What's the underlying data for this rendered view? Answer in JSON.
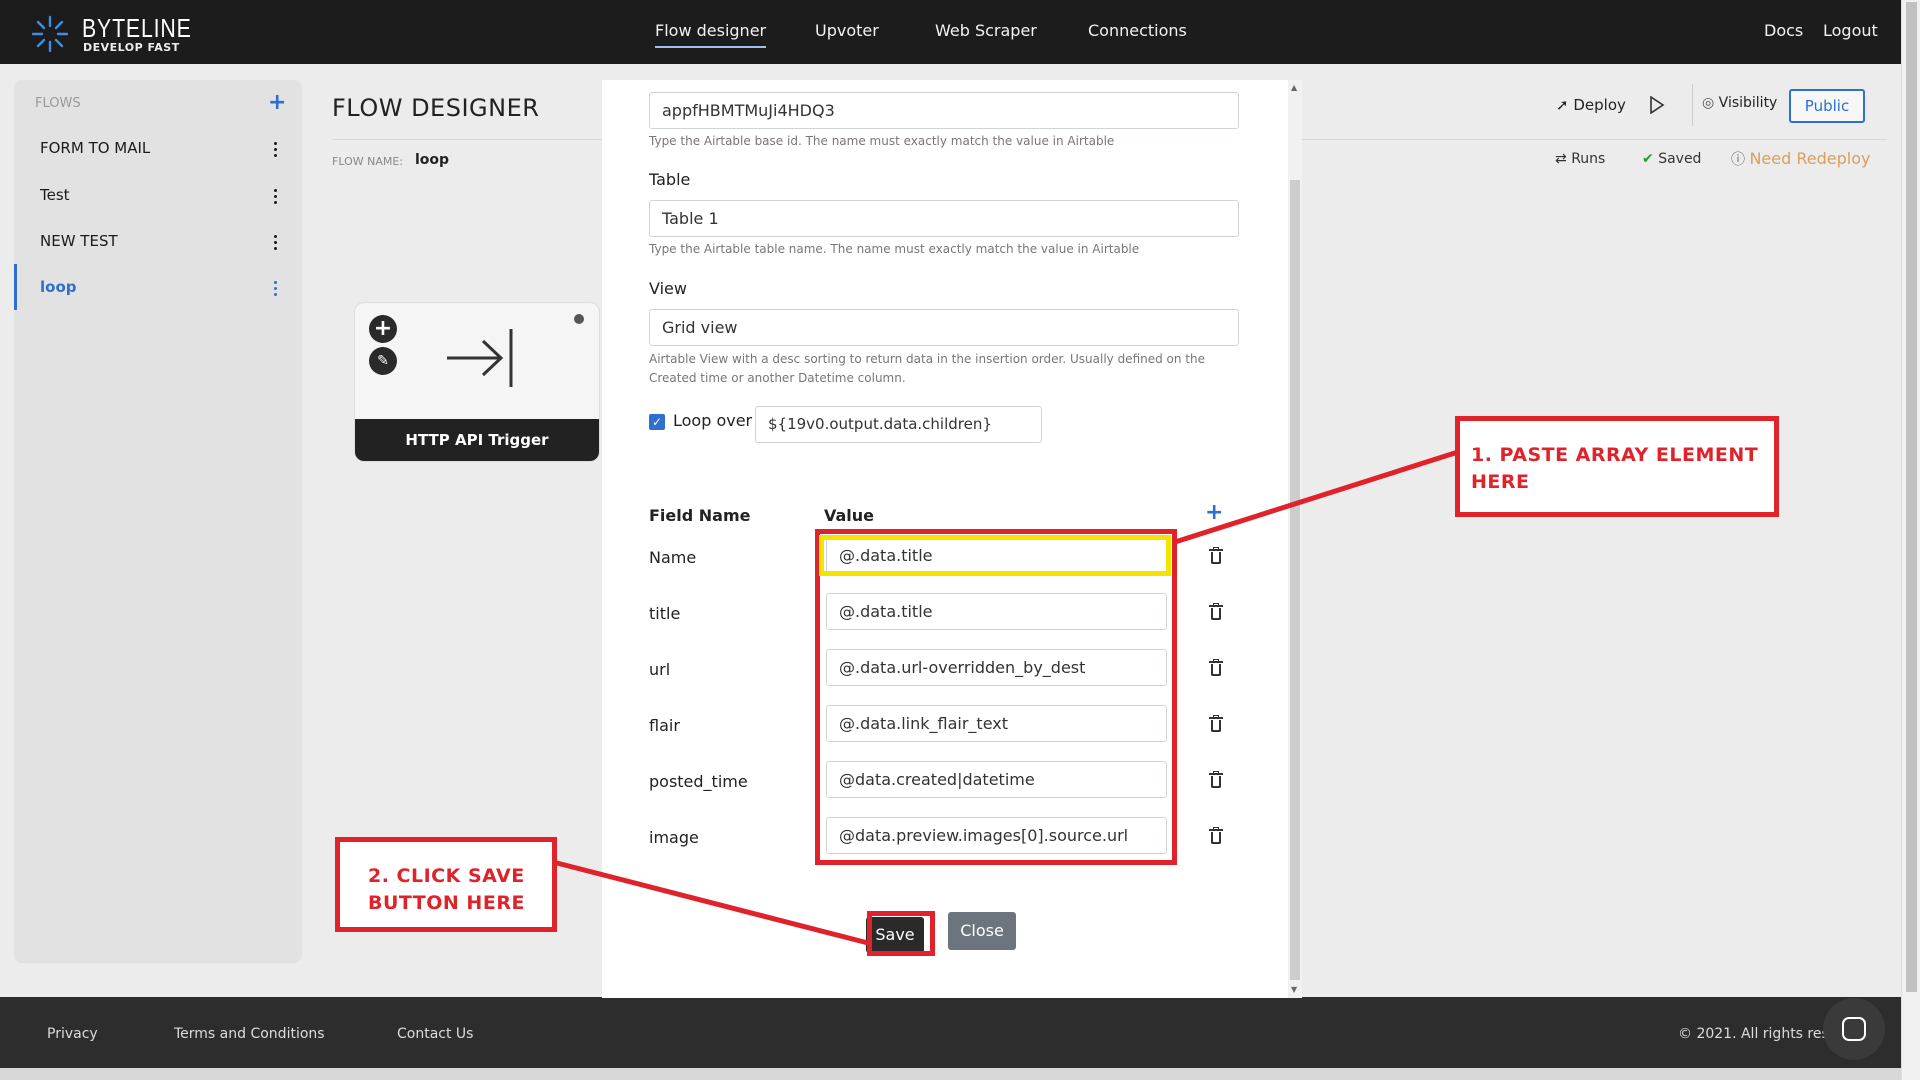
{
  "brand": {
    "name": "BYTELINE",
    "tagline": "DEVELOP FAST"
  },
  "nav": {
    "links": [
      "Flow designer",
      "Upvoter",
      "Web Scraper",
      "Connections"
    ],
    "right": [
      "Docs",
      "Logout"
    ]
  },
  "sidebar": {
    "heading": "FLOWS",
    "add": "+",
    "items": [
      {
        "label": "FORM TO MAIL"
      },
      {
        "label": "Test"
      },
      {
        "label": "NEW TEST"
      },
      {
        "label": "loop",
        "active": true
      }
    ]
  },
  "main": {
    "title": "FLOW DESIGNER",
    "flow_name_label": "FLOW NAME:",
    "flow_name": "loop",
    "deploy": "Deploy",
    "visibility": "Visibility",
    "public": "Public",
    "runs": "Runs",
    "saved": "Saved",
    "need_redeploy": "Need Redeploy"
  },
  "node": {
    "title": "HTTP API Trigger"
  },
  "modal": {
    "base_id_value": "appfHBMTMuJi4HDQ3",
    "base_id_help": "Type the Airtable base id. The name must exactly match the value in Airtable",
    "table_label": "Table",
    "table_value": "Table 1",
    "table_help": "Type the Airtable table name. The name must exactly match the value in Airtable",
    "view_label": "View",
    "view_value": "Grid view",
    "view_help_1": "Airtable View with a desc sorting to return data in the insertion order. Usually defined on the",
    "view_help_2": "Created time or another Datetime column.",
    "loop_label": "Loop over",
    "loop_checked": true,
    "loop_value": "${19v0.output.data.children}",
    "field_name_header": "Field Name",
    "value_header": "Value",
    "fields": [
      {
        "name": "Name",
        "value": "@.data.title"
      },
      {
        "name": "title",
        "value": "@.data.title"
      },
      {
        "name": "url",
        "value": "@.data.url-overridden_by_dest"
      },
      {
        "name": "flair",
        "value": "@.data.link_flair_text"
      },
      {
        "name": "posted_time",
        "value": "@data.created|datetime"
      },
      {
        "name": "image",
        "value": "@data.preview.images[0].source.url"
      }
    ],
    "save": "Save",
    "close": "Close"
  },
  "annotations": {
    "step1_line1": "1. PASTE ARRAY ELEMENT",
    "step1_line2": "HERE",
    "step2_line1": "2. CLICK SAVE",
    "step2_line2": "BUTTON HERE",
    "color": "#e0232b",
    "highlight": "#f5e400"
  },
  "footer": {
    "links": [
      "Privacy",
      "Terms and Conditions",
      "Contact Us"
    ],
    "copyright": "© 2021. All rights rese"
  },
  "colors": {
    "accent": "#2f6fd0",
    "navbar": "#1c1c1c",
    "warning": "#d9a05a"
  }
}
